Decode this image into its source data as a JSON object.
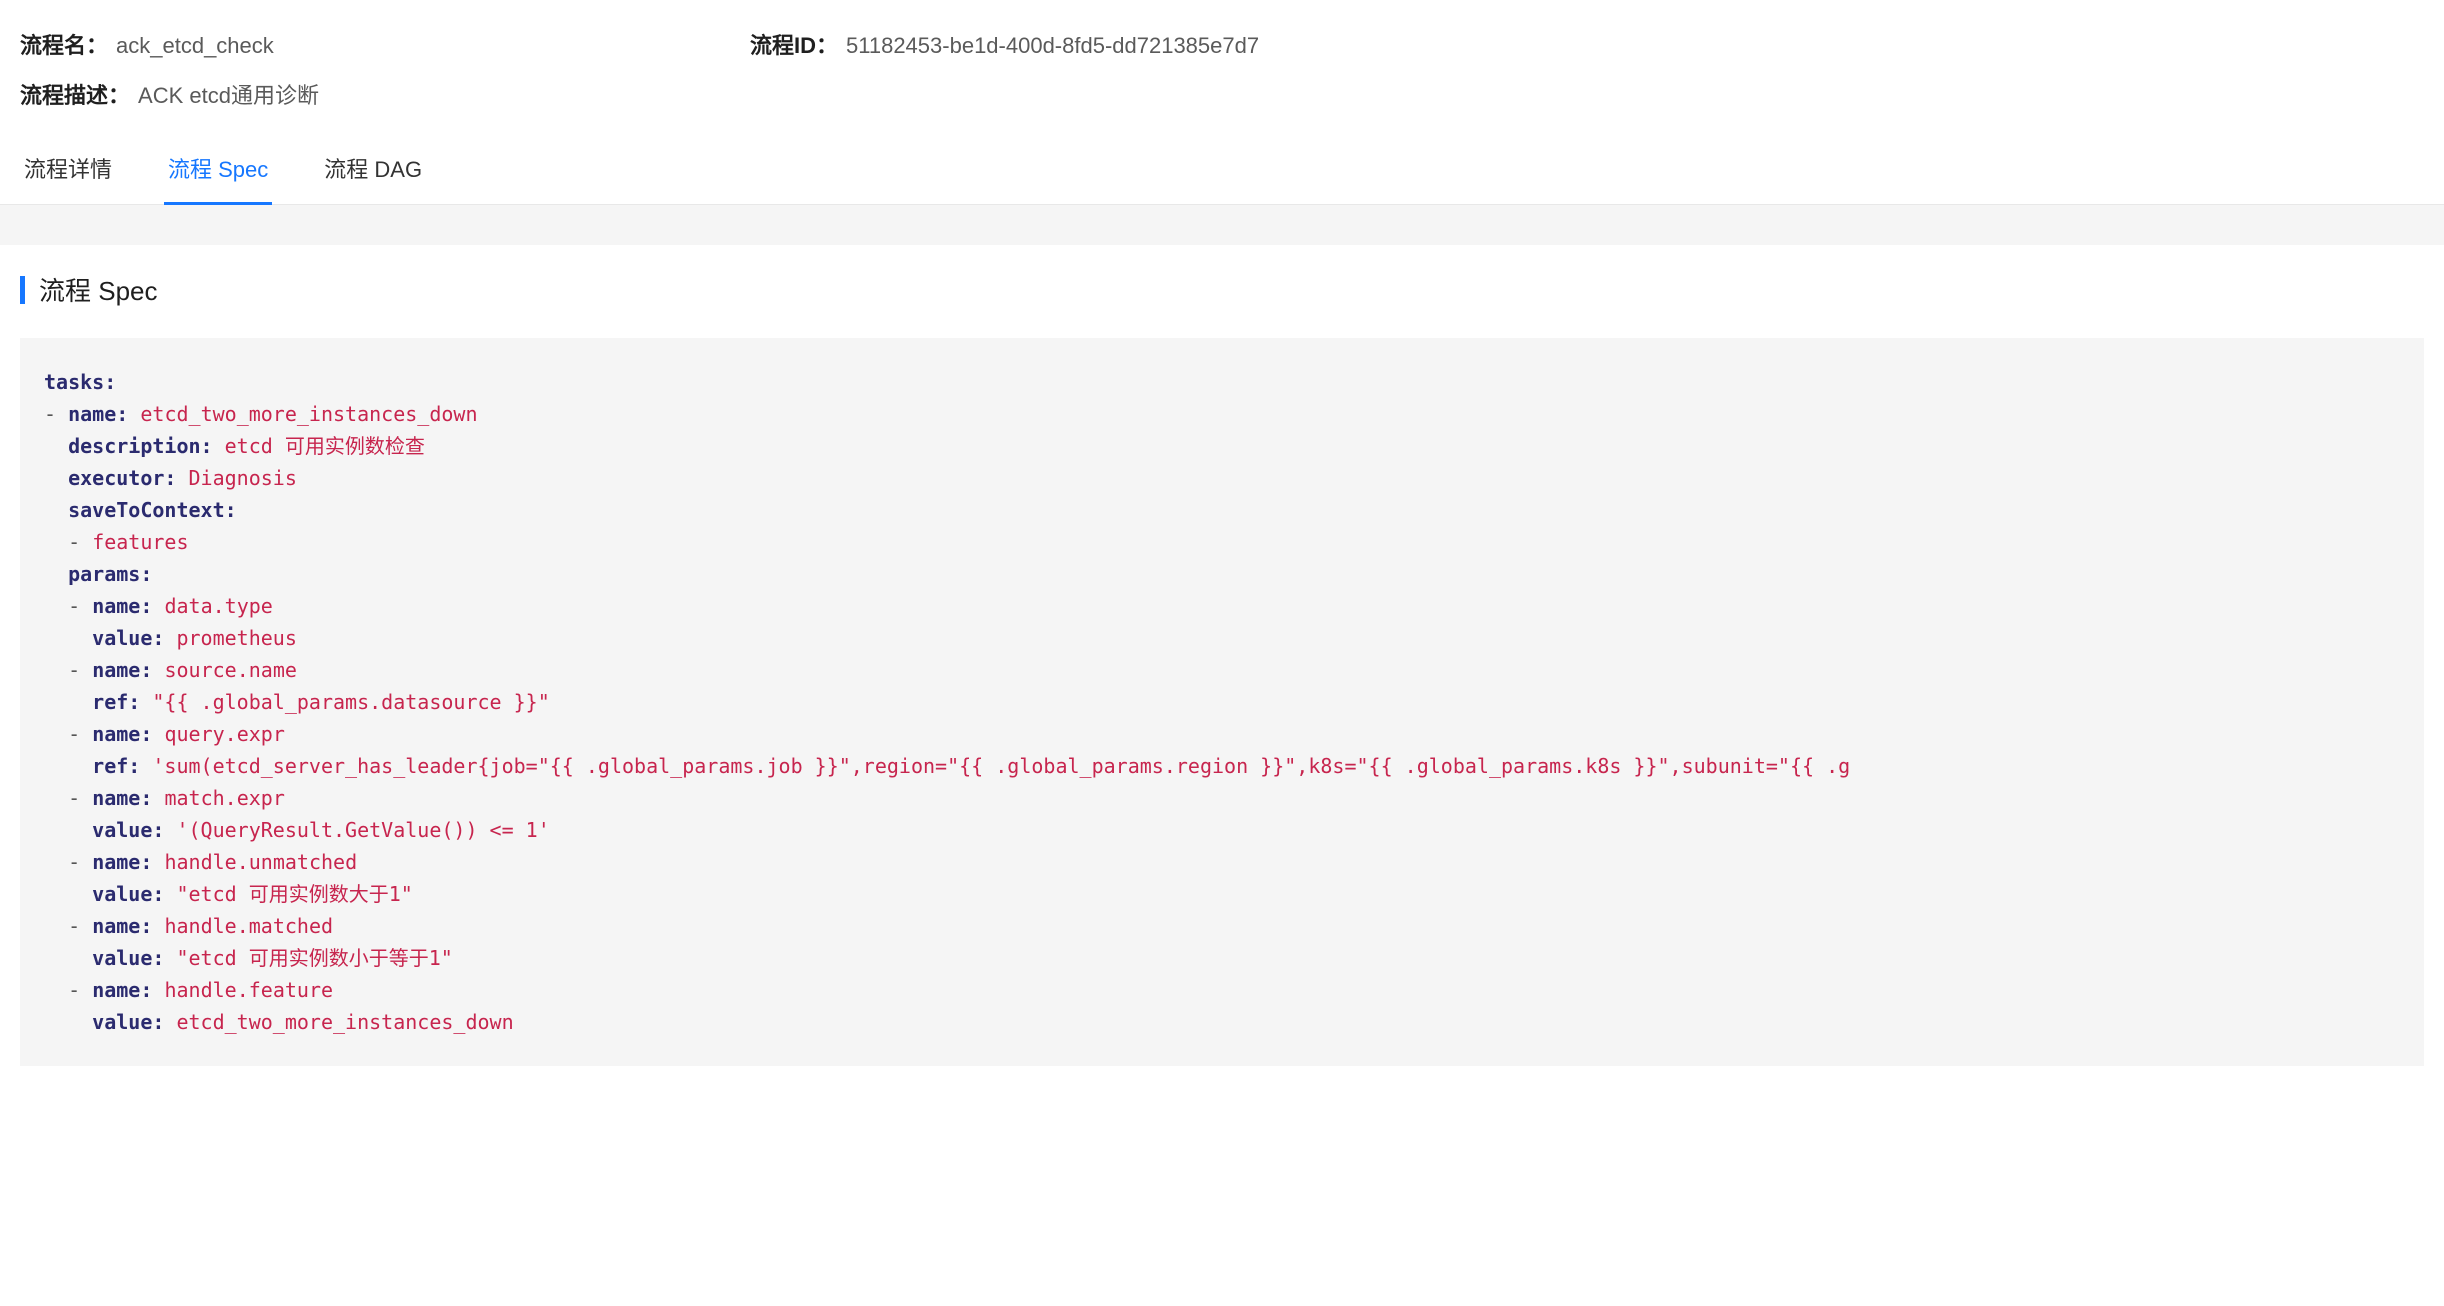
{
  "header": {
    "name_label": "流程名：",
    "name_value": "ack_etcd_check",
    "id_label": "流程ID：",
    "id_value": "51182453-be1d-400d-8fd5-dd721385e7d7",
    "desc_label": "流程描述：",
    "desc_value": "ACK etcd通用诊断"
  },
  "tabs": {
    "t0": "流程详情",
    "t1": "流程 Spec",
    "t2": "流程 DAG"
  },
  "section": {
    "title": "流程 Spec"
  },
  "spec": {
    "tasks_key": "tasks:",
    "dash": "-",
    "name_key": "name:",
    "desc_key": "description:",
    "executor_key": "executor:",
    "save_key": "saveToContext:",
    "save_item": "features",
    "params_key": "params:",
    "value_key": "value:",
    "ref_key": "ref:",
    "task_name": "etcd_two_more_instances_down",
    "task_desc": "etcd 可用实例数检查",
    "task_executor": "Diagnosis",
    "p0_name": "data.type",
    "p0_value": "prometheus",
    "p1_name": "source.name",
    "p1_ref": "\"{{ .global_params.datasource }}\"",
    "p2_name": "query.expr",
    "p2_ref": "'sum(etcd_server_has_leader{job=\"{{ .global_params.job }}\",region=\"{{ .global_params.region }}\",k8s=\"{{ .global_params.k8s }}\",subunit=\"{{ .g",
    "p3_name": "match.expr",
    "p3_value": "'(QueryResult.GetValue()) <= 1'",
    "p4_name": "handle.unmatched",
    "p4_value": "\"etcd 可用实例数大于1\"",
    "p5_name": "handle.matched",
    "p5_value": "\"etcd 可用实例数小于等于1\"",
    "p6_name": "handle.feature",
    "p6_value": "etcd_two_more_instances_down"
  }
}
